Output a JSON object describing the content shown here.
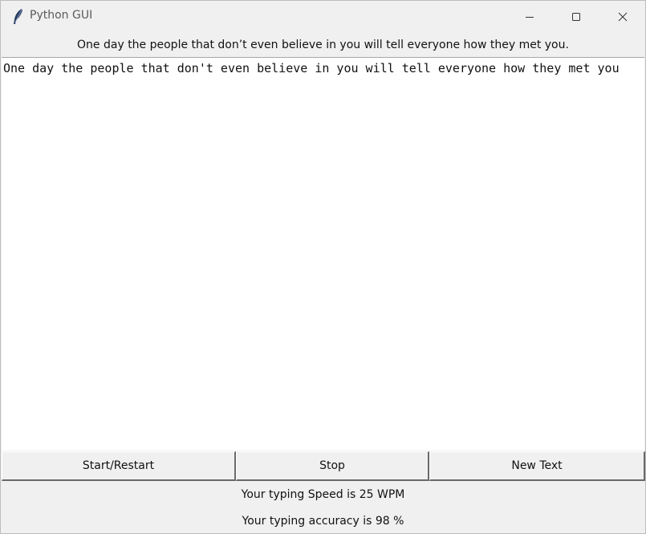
{
  "window": {
    "title": "Python GUI",
    "app_icon": "feather-icon"
  },
  "window_controls": {
    "minimize_icon": "minimize-icon",
    "maximize_icon": "maximize-icon",
    "close_icon": "close-icon"
  },
  "prompt": {
    "text": "One day the people that don’t even believe in you will tell everyone how they met you."
  },
  "editor": {
    "value": "One day the people that don't even believe in you will tell everyone how they met you"
  },
  "buttons": {
    "start_restart": "Start/Restart",
    "stop": "Stop",
    "new_text": "New Text"
  },
  "results": {
    "speed": "Your typing Speed is 25 WPM",
    "accuracy": "Your typing accuracy is 98 %"
  },
  "colors": {
    "window_bg": "#f0f0f0",
    "text_area_bg": "#ffffff",
    "text": "#111111"
  }
}
